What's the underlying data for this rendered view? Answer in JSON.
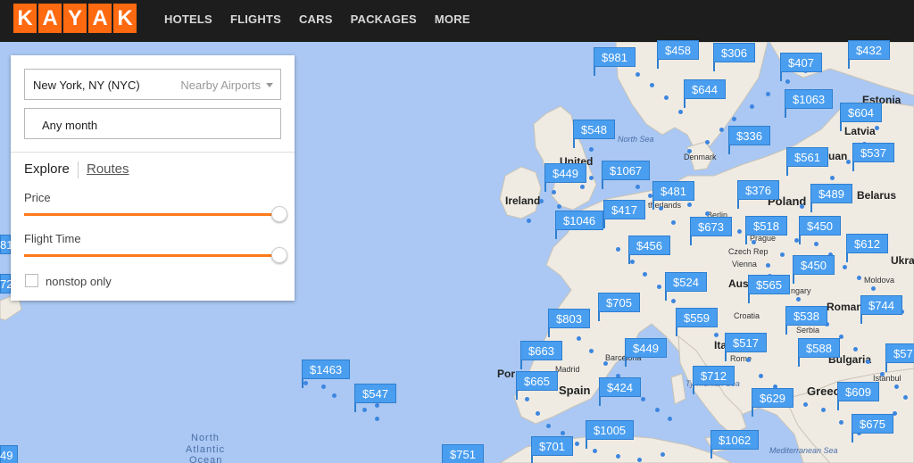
{
  "brand": {
    "letters": [
      "K",
      "A",
      "Y",
      "A",
      "K"
    ],
    "color": "#ff690f"
  },
  "nav": {
    "items": [
      "HOTELS",
      "FLIGHTS",
      "CARS",
      "PACKAGES",
      "MORE"
    ]
  },
  "search": {
    "origin": "New York, NY (NYC)",
    "nearby": "Nearby Airports",
    "month": "Any month",
    "tabs": {
      "explore": "Explore",
      "routes": "Routes"
    },
    "price_label": "Price",
    "price_level": 1.0,
    "flight_time_label": "Flight Time",
    "flight_time_level": 1.0,
    "nonstop_label": "nonstop only",
    "nonstop_checked": false
  },
  "map": {
    "countries": [
      "United",
      "Ireland",
      "Denmark",
      "Poland",
      "Belarus",
      "Estonia",
      "Latvia",
      "Czech Rep",
      "Austria",
      "Hungary",
      "Croatia",
      "Serbia",
      "Romania",
      "Bulgaria",
      "Moldova",
      "Ukra",
      "Spain",
      "Portugal",
      "Greece",
      "Italy",
      "Netherlands",
      "Lithuania"
    ],
    "country_labels": {
      "united": "United",
      "ireland": "Ireland",
      "denmark": "Denmark",
      "poland": "Poland",
      "belarus": "Belarus",
      "estonia": "Estonia",
      "latvia": "Latvia",
      "czech": "Czech Rep",
      "austria": "Aust",
      "hungary": "ngary",
      "croatia": "Croatia",
      "serbia": "Serbia",
      "romania": "Roman",
      "bulgaria": "Bulgaria",
      "moldova": "Moldova",
      "ukraine": "Ukra",
      "spain": "Spain",
      "portugal": "Por",
      "greece": "Greec",
      "italy": "Ita",
      "netherlands": "therlands",
      "lithuania": "uan"
    },
    "city_labels": {
      "madrid": "Madrid",
      "barcelona": "Barcelona",
      "rome": "Rome",
      "prague": "Prague",
      "vienna": "Vienna",
      "berlin": "Berlin",
      "istanbul": "Istanbul"
    },
    "seas": {
      "north_sea": "North Sea",
      "tyrrhenian": "Tyrrhenian Sea",
      "mediterranean": "Mediterranean Sea",
      "north_atlantic_1": "North",
      "north_atlantic_2": "Atlantic",
      "north_atlantic_3": "Ocean"
    },
    "edge_fragments": [
      "81",
      "72",
      "49"
    ],
    "prices": [
      "$981",
      "$458",
      "$306",
      "$432",
      "$407",
      "$644",
      "$1063",
      "$604",
      "$548",
      "$336",
      "$561",
      "$537",
      "$449",
      "$1067",
      "$481",
      "$376",
      "$489",
      "$1046",
      "$417",
      "$673",
      "$518",
      "$450",
      "$612",
      "$456",
      "$450",
      "$524",
      "$565",
      "$705",
      "$559",
      "$538",
      "$744",
      "$803",
      "$449",
      "$517",
      "$588",
      "$663",
      "$712",
      "$57",
      "$665",
      "$424",
      "$629",
      "$609",
      "$1463",
      "$547",
      "$1005",
      "$675",
      "$701",
      "$1062",
      "$751"
    ]
  }
}
